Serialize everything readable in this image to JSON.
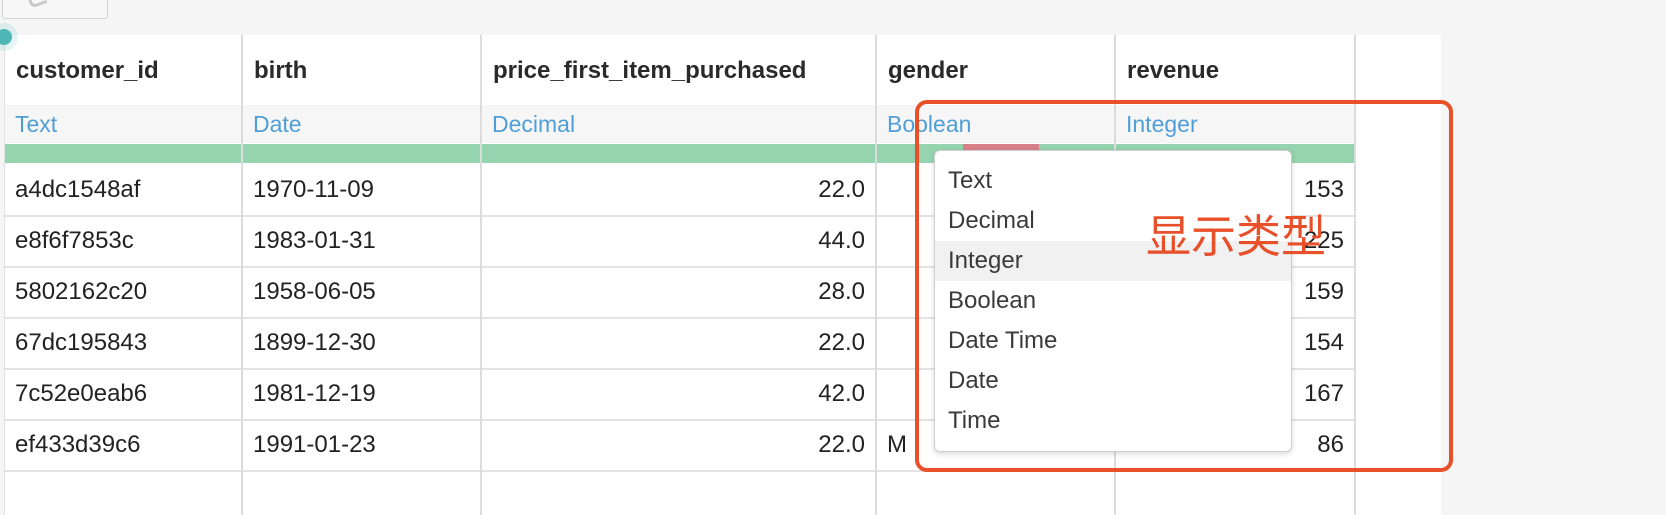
{
  "columns": [
    {
      "name": "customer_id",
      "type": "Text",
      "align": "left",
      "values": [
        "a4dc1548af",
        "e8f6f7853c",
        "5802162c20",
        "67dc195843",
        "7c52e0eab6",
        "ef433d39c6"
      ]
    },
    {
      "name": "birth",
      "type": "Date",
      "align": "left",
      "values": [
        "1970-11-09",
        "1983-01-31",
        "1958-06-05",
        "1899-12-30",
        "1981-12-19",
        "1991-01-23"
      ]
    },
    {
      "name": "price_first_item_purchased",
      "type": "Decimal",
      "align": "right",
      "values": [
        "22.0",
        "44.0",
        "28.0",
        "22.0",
        "42.0",
        "22.0"
      ]
    },
    {
      "name": "gender",
      "type": "Boolean",
      "align": "left",
      "values": [
        "",
        "",
        "",
        "",
        "",
        "M"
      ]
    },
    {
      "name": "revenue",
      "type": "Integer",
      "align": "right",
      "values": [
        "153",
        "225",
        "159",
        "154",
        "167",
        "86"
      ]
    }
  ],
  "type_menu": {
    "items": [
      "Text",
      "Decimal",
      "Integer",
      "Boolean",
      "Date Time",
      "Date",
      "Time"
    ],
    "hovered": "Integer"
  },
  "annotation": {
    "text": "显示类型",
    "color": "#e8502a"
  },
  "colors": {
    "type_label": "#4f9fd6",
    "quality_ok": "#95d4ae",
    "quality_bad": "#d8808a"
  }
}
